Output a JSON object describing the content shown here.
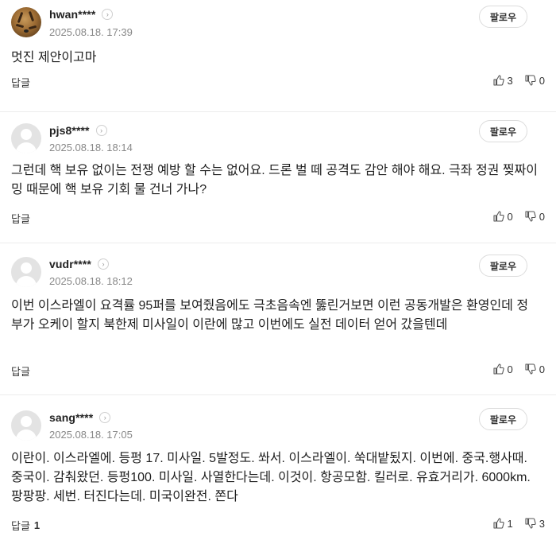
{
  "comments": [
    {
      "username": "hwan****",
      "date": "2025.08.18. 17:39",
      "follow_label": "팔로우",
      "text": "멋진 제안이고마",
      "reply_label": "답글",
      "reply_count": "",
      "likes": "3",
      "dislikes": "0"
    },
    {
      "username": "pjs8****",
      "date": "2025.08.18. 18:14",
      "follow_label": "팔로우",
      "text": "그런데 핵 보유 없이는 전쟁 예방 할 수는 없어요. 드론 벌 떼 공격도 감안 해야 해요. 극좌 정권 찢짜이밍 때문에 핵 보유 기회 물 건너 가나?",
      "reply_label": "답글",
      "reply_count": "",
      "likes": "0",
      "dislikes": "0"
    },
    {
      "username": "vudr****",
      "date": "2025.08.18. 18:12",
      "follow_label": "팔로우",
      "text": "이번 이스라엘이 요격률 95퍼를 보여줬음에도 극초음속엔 뚫린거보면 이런 공동개발은 환영인데 정부가 오케이 할지 북한제 미사일이 이란에 많고 이번에도 실전 데이터 얻어 갔을텐데",
      "reply_label": "답글",
      "reply_count": "",
      "likes": "0",
      "dislikes": "0"
    },
    {
      "username": "sang****",
      "date": "2025.08.18. 17:05",
      "follow_label": "팔로우",
      "text": "이란이. 이스라엘에. 등펑 17. 미사일. 5발정도. 쏴서. 이스라엘이. 쑥대밭됬지. 이번에. 중국.행사때. 중국이. 감춰왔던. 등펑100. 미사일. 사열한다는데. 이것이. 항공모함. 킬러로. 유효거리가. 6000km. 팡팡팡. 세번. 터진다는데. 미국이완전. 쫀다",
      "reply_label": "답글",
      "reply_count": "1",
      "likes": "1",
      "dislikes": "3"
    }
  ]
}
